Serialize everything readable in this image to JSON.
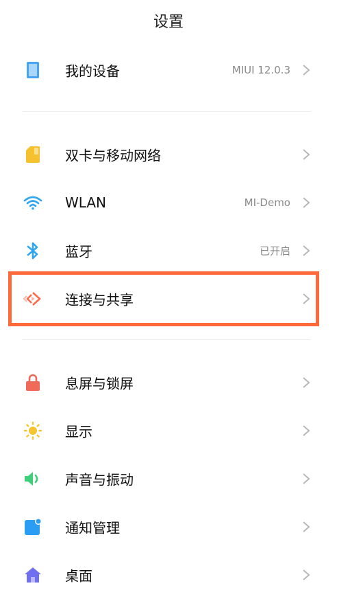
{
  "header": {
    "title": "设置"
  },
  "items": [
    {
      "label": "我的设备",
      "value": "MIUI 12.0.3",
      "icon": "device-icon"
    },
    {
      "label": "双卡与移动网络",
      "value": "",
      "icon": "sim-card-icon"
    },
    {
      "label": "WLAN",
      "value": "MI-Demo",
      "icon": "wifi-icon"
    },
    {
      "label": "蓝牙",
      "value": "已开启",
      "icon": "bluetooth-icon"
    },
    {
      "label": "连接与共享",
      "value": "",
      "icon": "connection-share-icon"
    },
    {
      "label": "息屏与锁屏",
      "value": "",
      "icon": "lock-icon"
    },
    {
      "label": "显示",
      "value": "",
      "icon": "sun-icon"
    },
    {
      "label": "声音与振动",
      "value": "",
      "icon": "speaker-icon"
    },
    {
      "label": "通知管理",
      "value": "",
      "icon": "notification-icon"
    },
    {
      "label": "桌面",
      "value": "",
      "icon": "home-icon"
    }
  ],
  "colors": {
    "highlight": "#ff6a3d",
    "device": "#4aa3f0",
    "sim": "#f5c12e",
    "wifi": "#2ea6f2",
    "bluetooth": "#2ea6f2",
    "connection": "#ff6a4d",
    "lock": "#f06a5a",
    "sun": "#f7c534",
    "speaker": "#3fcf7a",
    "notification": "#2b9ef3",
    "home": "#6f6ff0"
  }
}
